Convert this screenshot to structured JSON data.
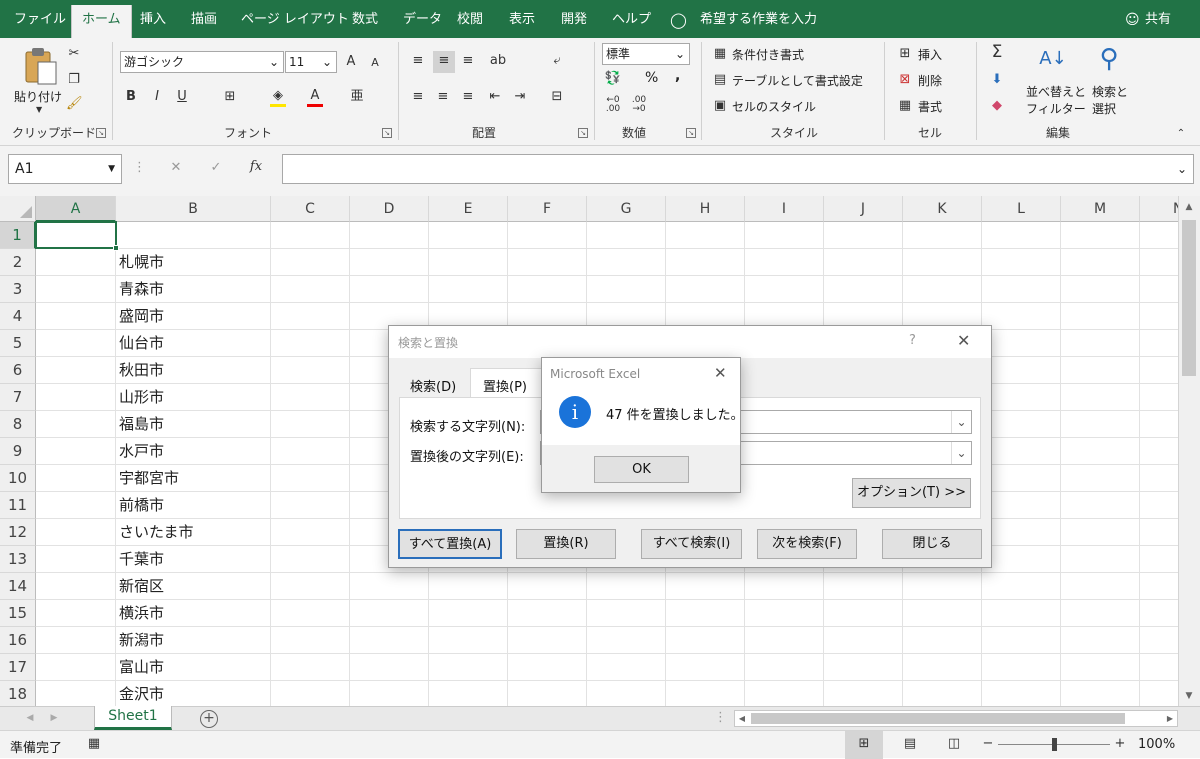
{
  "menu": {
    "tabs": [
      "ファイル",
      "ホーム",
      "挿入",
      "描画",
      "ページ レイアウト",
      "数式",
      "データ",
      "校閲",
      "表示",
      "開発",
      "ヘルプ"
    ],
    "tell_me": "希望する作業を入力",
    "share": "共有"
  },
  "ribbon": {
    "clipboard": {
      "paste": "貼り付け",
      "label": "クリップボード"
    },
    "font": {
      "name": "游ゴシック",
      "size": "11",
      "label": "フォント"
    },
    "alignment": {
      "label": "配置"
    },
    "number": {
      "format": "標準",
      "label": "数値",
      "percent": "%",
      "comma": ","
    },
    "styles": {
      "conditional": "条件付き書式",
      "table": "テーブルとして書式設定",
      "cell_styles": "セルのスタイル",
      "label": "スタイル"
    },
    "cells": {
      "insert": "挿入",
      "delete": "削除",
      "format": "書式",
      "label": "セル"
    },
    "editing": {
      "sort_line1": "並べ替えと",
      "sort_line2": "フィルター",
      "find_line1": "検索と",
      "find_line2": "選択",
      "label": "編集"
    }
  },
  "formula_bar": {
    "name_box": "A1",
    "fx": "fx",
    "content": ""
  },
  "grid": {
    "columns": [
      "A",
      "B",
      "C",
      "D",
      "E",
      "F",
      "G",
      "H",
      "I",
      "J",
      "K",
      "L",
      "M",
      "N"
    ],
    "rows": [
      "1",
      "2",
      "3",
      "4",
      "5",
      "6",
      "7",
      "8",
      "9",
      "10",
      "11",
      "12",
      "13",
      "14",
      "15",
      "16",
      "17",
      "18"
    ],
    "column_b": [
      "",
      "札幌市",
      "青森市",
      "盛岡市",
      "仙台市",
      "秋田市",
      "山形市",
      "福島市",
      "水戸市",
      "宇都宮市",
      "前橋市",
      "さいたま市",
      "千葉市",
      "新宿区",
      "横浜市",
      "新潟市",
      "富山市",
      "金沢市"
    ]
  },
  "sheet_tab": "Sheet1",
  "status": {
    "ready": "準備完了",
    "zoom": "100%"
  },
  "find_dialog": {
    "title": "検索と置換",
    "help": "?",
    "tab_find": "検索(D)",
    "tab_replace": "置換(P)",
    "find_label": "検索する文字列(N):",
    "replace_label": "置換後の文字列(E):",
    "options_button": "オプション(T) >>",
    "replace_all": "すべて置換(A)",
    "replace": "置換(R)",
    "find_all": "すべて検索(I)",
    "find_next": "次を検索(F)",
    "close": "閉じる"
  },
  "message_box": {
    "title": "Microsoft Excel",
    "message": "47 件を置換しました。",
    "ok": "OK"
  }
}
